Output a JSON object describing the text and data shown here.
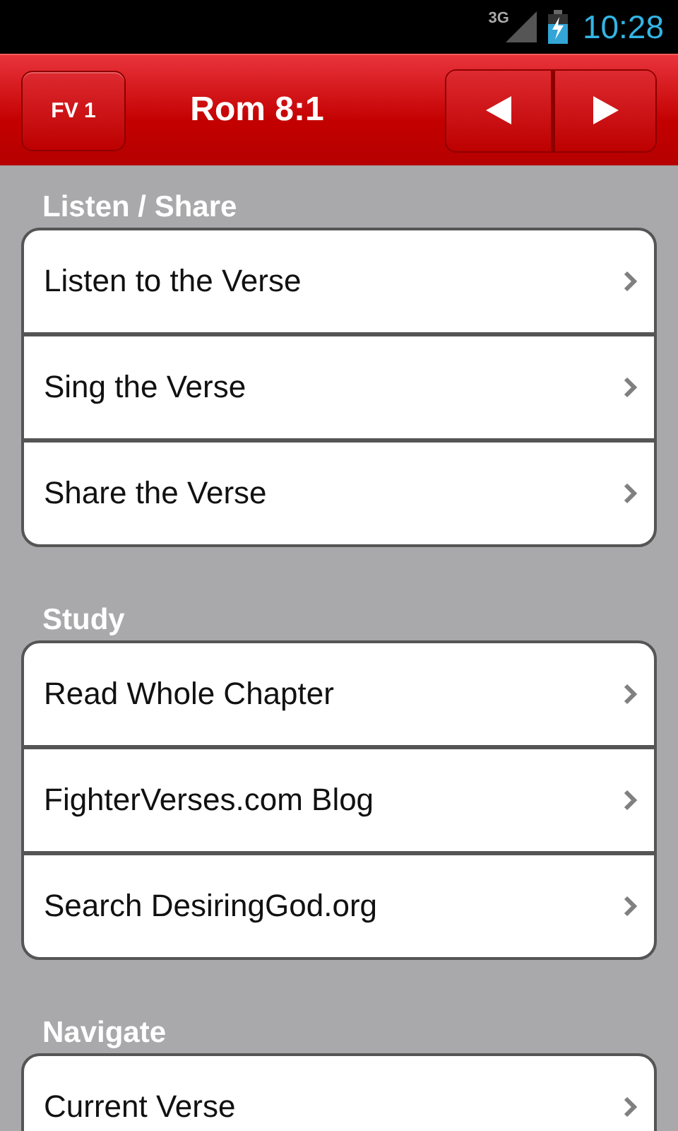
{
  "status_bar": {
    "network": "3G",
    "time": "10:28"
  },
  "header": {
    "left_button": "FV 1",
    "title": "Rom 8:1"
  },
  "sections": [
    {
      "heading": "Listen / Share",
      "items": [
        {
          "label": "Listen to the Verse"
        },
        {
          "label": "Sing the Verse"
        },
        {
          "label": "Share the Verse"
        }
      ]
    },
    {
      "heading": "Study",
      "items": [
        {
          "label": "Read Whole Chapter"
        },
        {
          "label": "FighterVerses.com Blog"
        },
        {
          "label": "Search DesiringGod.org"
        }
      ]
    },
    {
      "heading": "Navigate",
      "items": [
        {
          "label": "Current Verse"
        }
      ]
    }
  ]
}
